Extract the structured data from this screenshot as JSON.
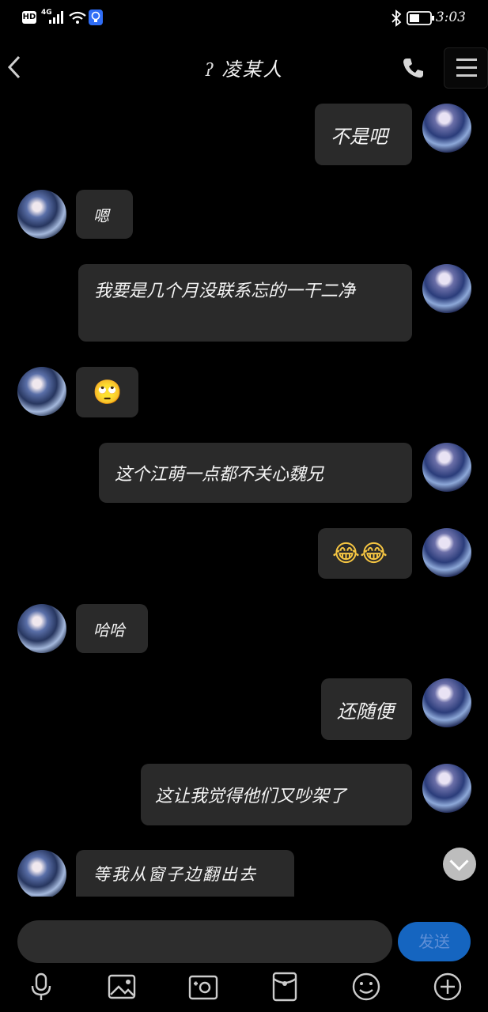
{
  "status_bar": {
    "hd": "HD",
    "network": "4G",
    "time": "3:03"
  },
  "header": {
    "title": "凌某人"
  },
  "messages": [
    {
      "side": "right",
      "text": "不是吧"
    },
    {
      "side": "left",
      "text": "嗯"
    },
    {
      "side": "right",
      "text": "我要是几个月没联系忘的一干二净"
    },
    {
      "side": "left",
      "emoji": "🙄"
    },
    {
      "side": "right",
      "text": "这个江萌一点都不关心魏兄"
    },
    {
      "side": "right",
      "emoji": "😂😂"
    },
    {
      "side": "left",
      "text": "哈哈"
    },
    {
      "side": "right",
      "text": "还随便"
    },
    {
      "side": "right",
      "text": "这让我觉得他们又吵架了"
    },
    {
      "side": "left",
      "text": "等我从窗子边翻出去"
    }
  ],
  "input": {
    "send_label": "发送"
  },
  "toolbar": [
    "mic-icon",
    "image-icon",
    "camera-icon",
    "red-packet-icon",
    "emoji-icon",
    "plus-icon"
  ],
  "colors": {
    "background": "#000000",
    "bubble": "#2a2a2a",
    "send_button": "#1565c0"
  }
}
